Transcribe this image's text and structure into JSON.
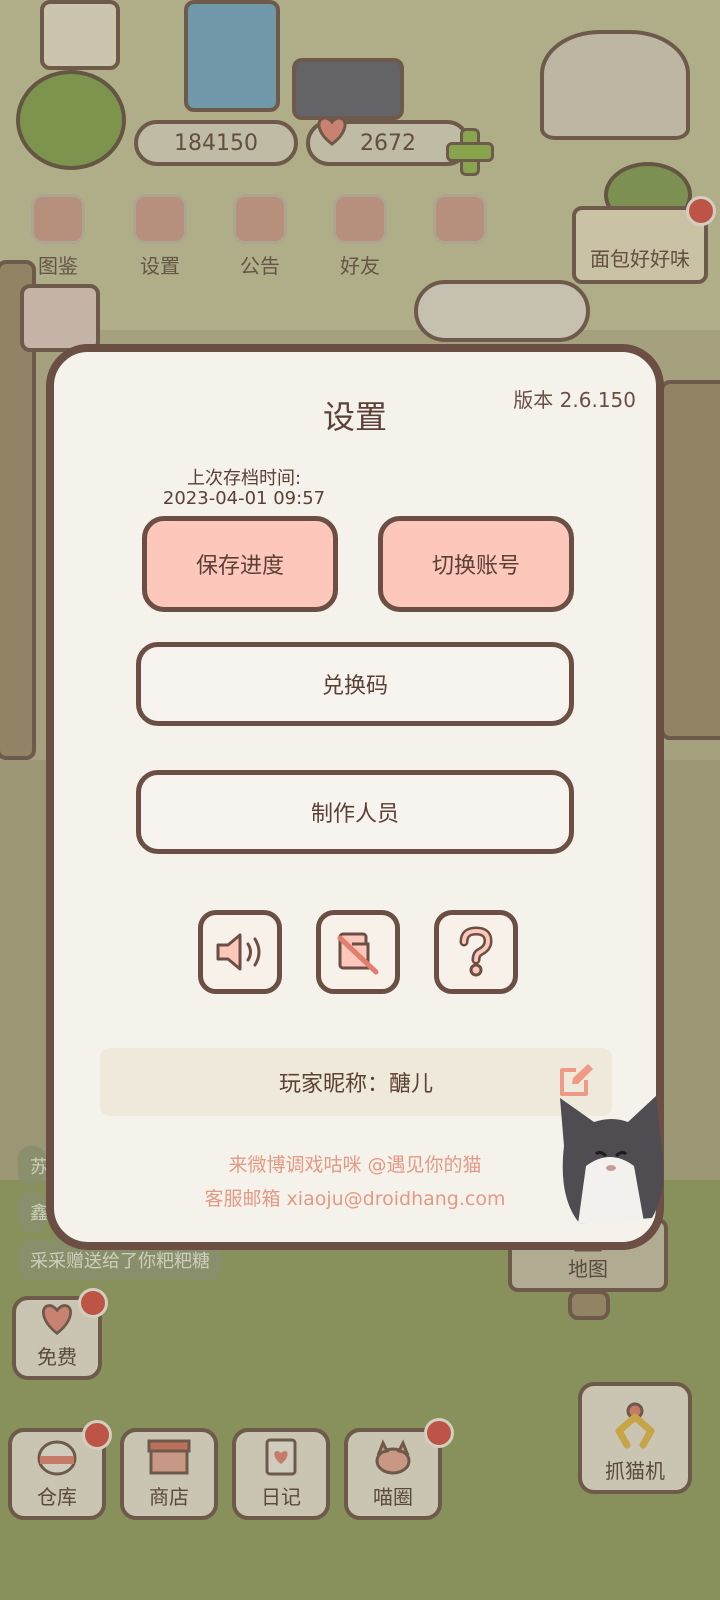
{
  "currency": {
    "coins": "184150",
    "hearts": "2672"
  },
  "top_menu": [
    {
      "label": "图鉴",
      "icon": "cat-book-icon"
    },
    {
      "label": "设置",
      "icon": "gear-icon"
    },
    {
      "label": "公告",
      "icon": "gift-icon"
    },
    {
      "label": "好友",
      "icon": "friends-icon"
    }
  ],
  "bread_sign": "面包好好味",
  "chat": {
    "line1": "苏",
    "line2": "鑫",
    "line3": "采采赠送给了你粑粑糖"
  },
  "bottom_bar": {
    "free": "免费",
    "warehouse": "仓库",
    "shop": "商店",
    "diary": "日记",
    "circle": "喵圈",
    "claw": "抓猫机",
    "map": "地图"
  },
  "settings": {
    "title": "设置",
    "version": "版本 2.6.150",
    "last_save_label": "上次存档时间:",
    "last_save_time": "2023-04-01 09:57",
    "save_button": "保存进度",
    "switch_button": "切换账号",
    "redeem_button": "兑换码",
    "credits_button": "制作人员",
    "nickname_label": "玩家昵称：",
    "nickname": "醣儿",
    "weibo": "来微博调戏咕咪 @遇见你的猫",
    "email": "客服邮箱 xiaoju@droidhang.com"
  },
  "colors": {
    "accent_pink": "#fdc7bb",
    "border_brown": "#6b4f44",
    "link_salmon": "#e39a84",
    "badge_red": "#d9473f"
  }
}
